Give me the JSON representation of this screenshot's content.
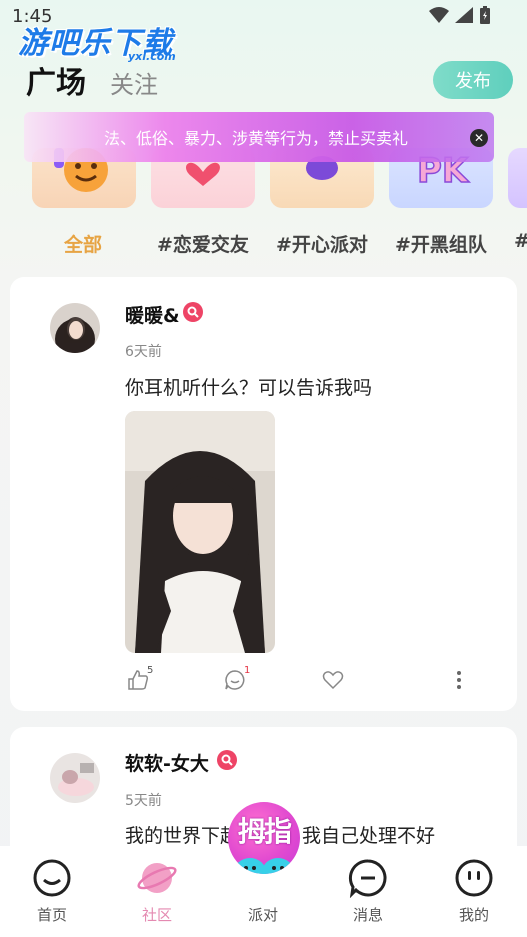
{
  "status": {
    "time": "1:45"
  },
  "watermark": {
    "main": "游吧乐下载",
    "sub": "yxl.com"
  },
  "header": {
    "tab_square": "广场",
    "tab_follow": "关注",
    "publish": "发布"
  },
  "notice": {
    "text": "法、低俗、暴力、涉黄等行为，禁止买卖礼"
  },
  "topics": [
    "全部",
    "#恋爱交友",
    "#开心派对",
    "#开黑组队",
    "#"
  ],
  "posts": [
    {
      "username": "暖暖&",
      "time": "6天前",
      "text": "你耳机听什么？可以告诉我吗",
      "likes": "5",
      "comments": "1"
    },
    {
      "username": "软软-女大",
      "time": "5天前",
      "text": "我的世界下起了小雨 我自己处理不好"
    }
  ],
  "nav": {
    "home": "首页",
    "community": "社区",
    "party": "派对",
    "messages": "消息",
    "mine": "我的",
    "center_button": "拇指"
  },
  "colors": {
    "accent_teal": "#5fcfbd",
    "topic_active": "#e7a444",
    "nav_active": "#e48ab1",
    "verified_badge": "#ee4466"
  }
}
